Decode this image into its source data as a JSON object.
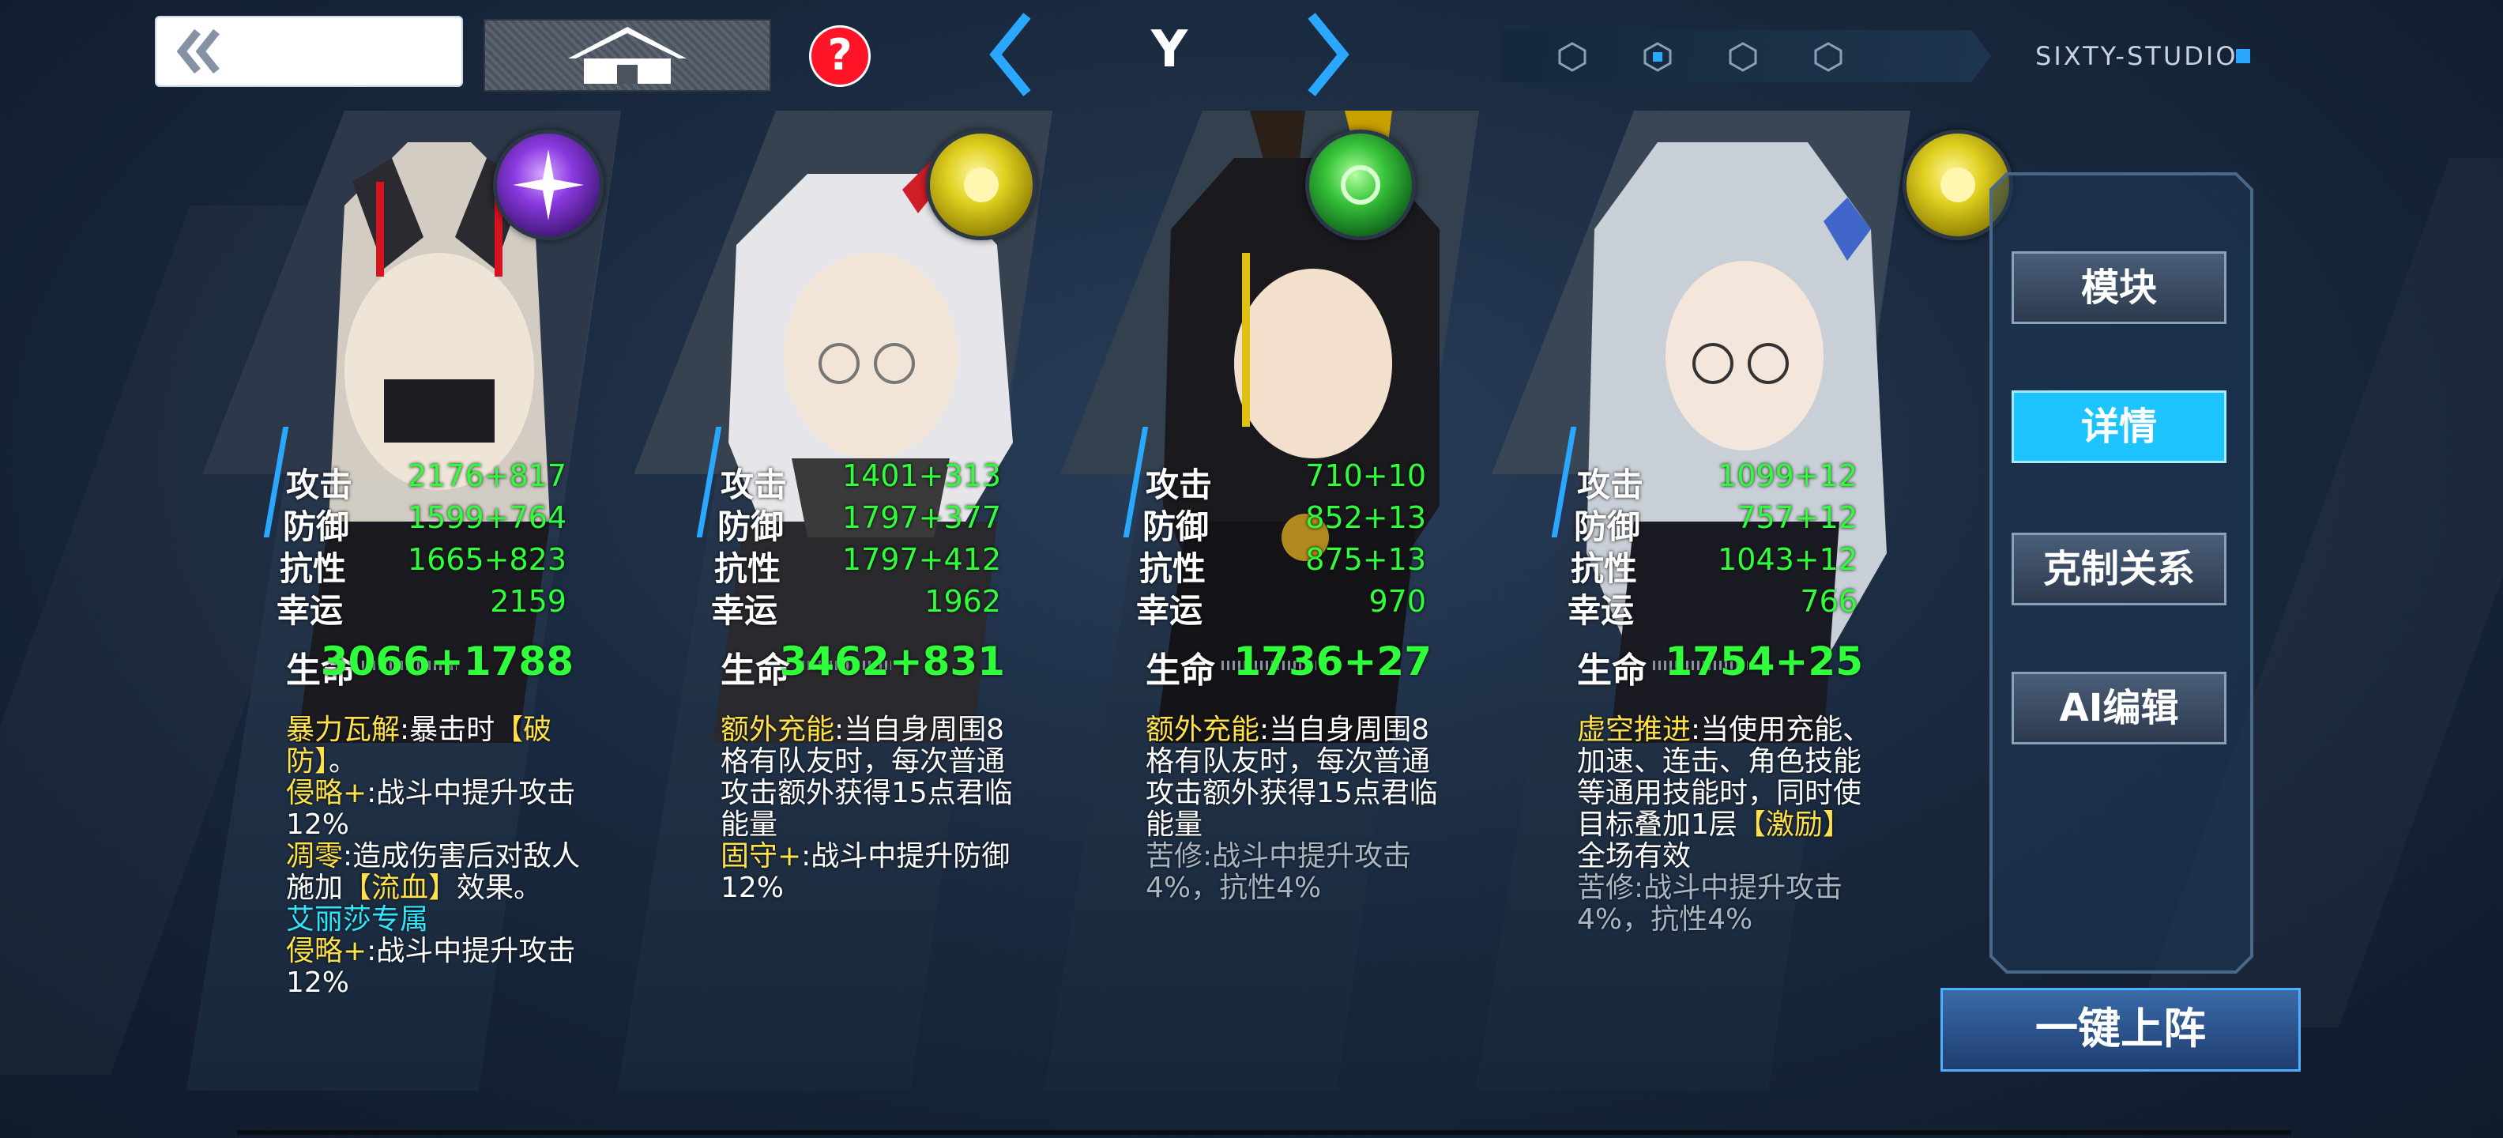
{
  "topbar": {
    "title": "Y",
    "studio": "SIXTY-STUDIO",
    "back_icon": "double-chevron-left-icon",
    "home_icon": "home-icon",
    "help_icon": "question-mark-icon",
    "help_glyph": "?",
    "page_dots": 4,
    "active_dot_index": 1
  },
  "colors": {
    "stat_green": "#2eff3a",
    "accent_cyan": "#1ec4ff",
    "skill_yellow": "#ffe14a",
    "skill_cyan": "#2ee6ff"
  },
  "cards": [
    {
      "element": "purple",
      "stats": [
        {
          "label": "攻击",
          "value": "2176+817"
        },
        {
          "label": "防御",
          "value": "1599+764"
        },
        {
          "label": "抗性",
          "value": "1665+823"
        },
        {
          "label": "幸运",
          "value": "2159"
        }
      ],
      "hp": {
        "label": "生命",
        "value": "3066+1788"
      },
      "skills": [
        {
          "name": "暴力瓦解",
          "text": ":暴击时",
          "tag": "【破防】",
          "tail": "。"
        },
        {
          "name": "侵略+",
          "text": ":战斗中提升攻击12%"
        },
        {
          "name": "凋零",
          "text": ":造成伤害后对敌人施加",
          "tag": "【流血】",
          "tail": "效果。"
        },
        {
          "name": "艾丽莎专属",
          "text": ""
        },
        {
          "name": "侵略+",
          "text": ":战斗中提升攻击12%"
        }
      ]
    },
    {
      "element": "yellow",
      "stats": [
        {
          "label": "攻击",
          "value": "1401+313"
        },
        {
          "label": "防御",
          "value": "1797+377"
        },
        {
          "label": "抗性",
          "value": "1797+412"
        },
        {
          "label": "幸运",
          "value": "1962"
        }
      ],
      "hp": {
        "label": "生命",
        "value": "3462+831"
      },
      "skills": [
        {
          "name": "额外充能",
          "text": ":当自身周围8格有队友时，每次普通攻击额外获得15点君临能量"
        },
        {
          "name": "固守+",
          "text": ":战斗中提升防御12%"
        }
      ]
    },
    {
      "element": "green",
      "stats": [
        {
          "label": "攻击",
          "value": "710+10"
        },
        {
          "label": "防御",
          "value": "852+13"
        },
        {
          "label": "抗性",
          "value": "875+13"
        },
        {
          "label": "幸运",
          "value": "970"
        }
      ],
      "hp": {
        "label": "生命",
        "value": "1736+27"
      },
      "skills": [
        {
          "name": "额外充能",
          "text": ":当自身周围8格有队友时，每次普通攻击额外获得15点君临能量"
        },
        {
          "name": "苦修",
          "text": ":战斗中提升攻击4%，抗性4%"
        }
      ]
    },
    {
      "element": "yellow",
      "stats": [
        {
          "label": "攻击",
          "value": "1099+12"
        },
        {
          "label": "防御",
          "value": "757+12"
        },
        {
          "label": "抗性",
          "value": "1043+12"
        },
        {
          "label": "幸运",
          "value": "766"
        }
      ],
      "hp": {
        "label": "生命",
        "value": "1754+25"
      },
      "skills": [
        {
          "name": "虚空推进",
          "text": ":当使用充能、加速、连击、角色技能等通用技能时，同时使目标叠加1层",
          "tag": "【激励】",
          "tail": "全场有效"
        },
        {
          "name": "苦修",
          "text": ":战斗中提升攻击4%，抗性4%"
        }
      ]
    }
  ],
  "side_menu": {
    "module": "模块",
    "details": "详情",
    "counter": "克制关系",
    "ai_edit": "AI编辑"
  },
  "deploy_label": "一键上阵"
}
